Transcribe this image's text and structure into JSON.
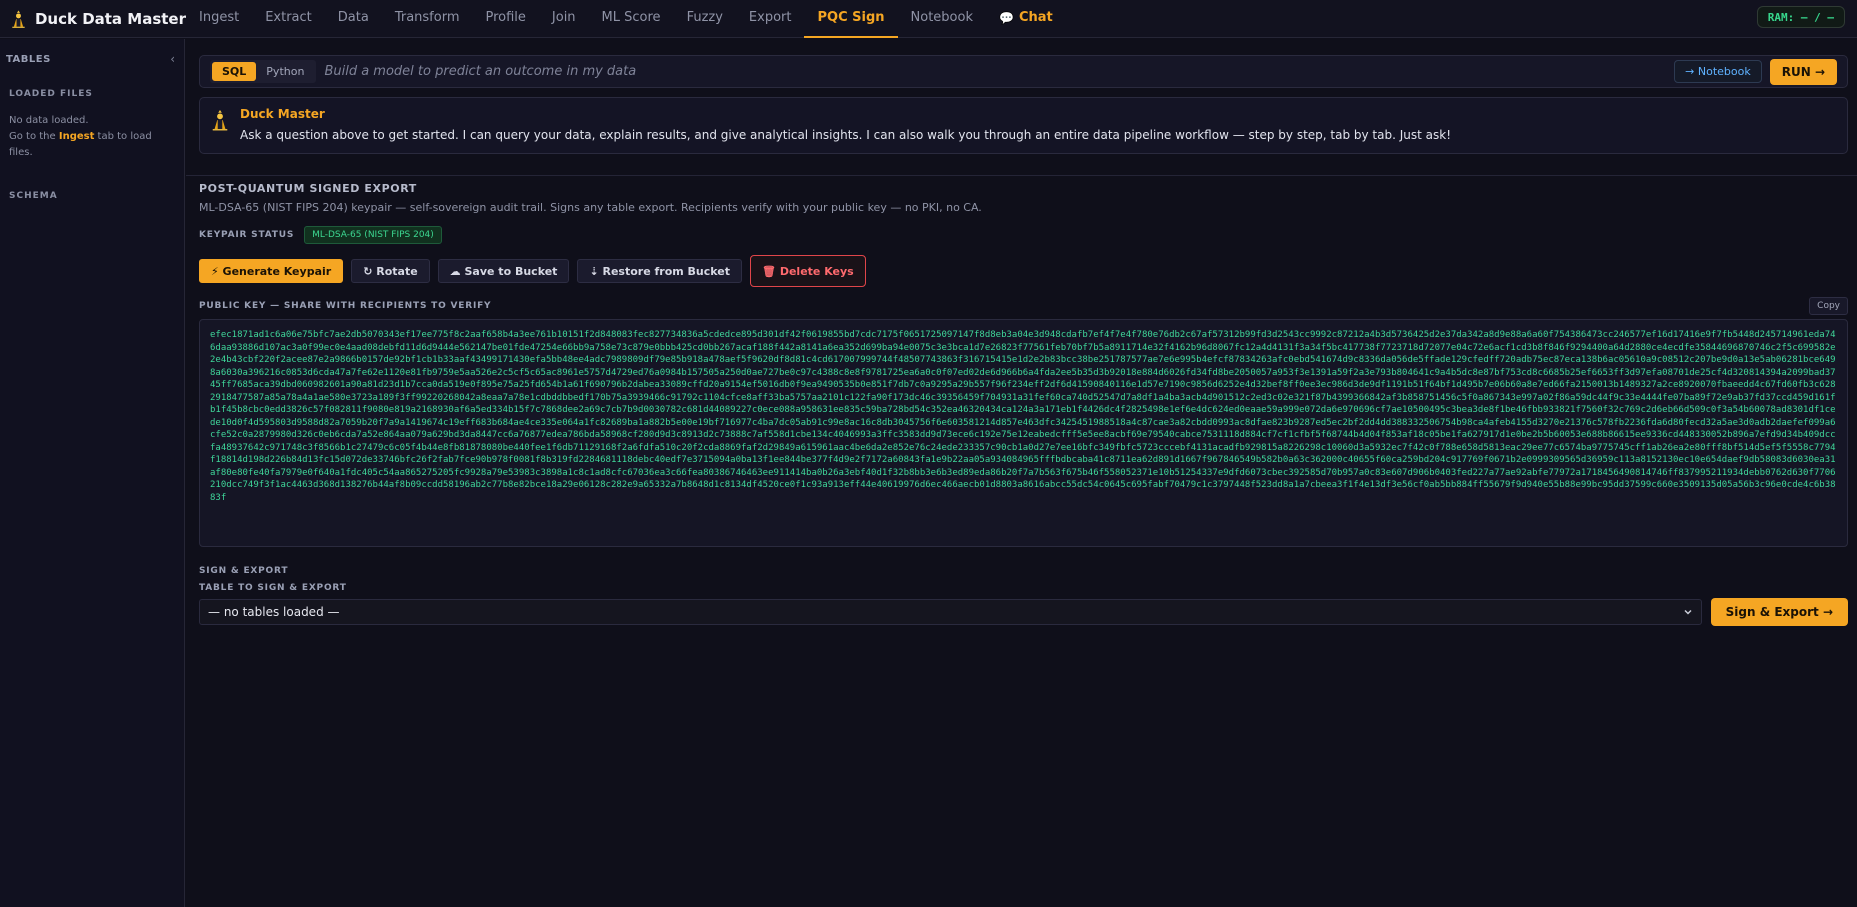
{
  "app": {
    "title": "Duck Data Master",
    "logo_icon": "duck-logo-icon"
  },
  "nav": {
    "tabs": [
      {
        "label": "Ingest"
      },
      {
        "label": "Extract"
      },
      {
        "label": "Data"
      },
      {
        "label": "Transform"
      },
      {
        "label": "Profile"
      },
      {
        "label": "Join"
      },
      {
        "label": "ML Score"
      },
      {
        "label": "Fuzzy"
      },
      {
        "label": "Export"
      },
      {
        "label": "PQC Sign",
        "active": true
      },
      {
        "label": "Notebook"
      },
      {
        "label": "Chat",
        "icon": "chat-icon"
      }
    ]
  },
  "ram": {
    "label": "RAM: — / —"
  },
  "sidebar": {
    "title": "TABLES",
    "collapse_glyph": "‹",
    "loaded_files_heading": "LOADED FILES",
    "empty_line1": "No data loaded.",
    "empty_line2_pre": "Go to the ",
    "empty_line2_link": "Ingest",
    "empty_line2_post": " tab to load files.",
    "schema_heading": "SCHEMA"
  },
  "query": {
    "modes": [
      "SQL",
      "Python"
    ],
    "active_mode": "SQL",
    "placeholder": "Build a model to predict an outcome in my data",
    "notebook_button": "→ Notebook",
    "run_button": "RUN →"
  },
  "assistant": {
    "name": "Duck Master",
    "message": "Ask a question above to get started. I can query your data, explain results, and give analytical insights. I can also walk you through an entire data pipeline workflow — step by step, tab by tab. Just ask!"
  },
  "pqc": {
    "title": "POST-QUANTUM SIGNED EXPORT",
    "subtitle": "ML-DSA-65 (NIST FIPS 204) keypair — self-sovereign audit trail. Signs any table export. Recipients verify with your public key — no PKI, no CA.",
    "keypair_status_label": "KEYPAIR STATUS",
    "keypair_status_badge": "ML-DSA-65 (NIST FIPS 204)",
    "buttons": {
      "generate": "⚡ Generate Keypair",
      "rotate": "↻ Rotate",
      "save": "☁ Save to Bucket",
      "restore": "⇣ Restore from Bucket",
      "delete": "🗑 Delete Keys"
    },
    "public_key_label": "PUBLIC KEY — SHARE WITH RECIPIENTS TO VERIFY",
    "copy_button": "Copy",
    "public_key": "efec1871ad1c6a06e75bfc7ae2db5070343ef17ee775f8c2aaf658b4a3ee761b10151f2d848083fec827734836a5cdedce895d301df42f0619855bd7cdc7175f0651725097147f8d8eb3a04e3d948cdafb7ef4f7e4f780e76db2c67af57312b99fd3d2543cc9992c87212a4b3d5736425d2e37da342a8d9e88a6a60f754386473cc246577ef16d17416e9f7fb5448d245714961eda746daa93886d107ac3a0f99ec0e4aad08debfd11d6d9444e562147be01fde47254e66bb9a758e73c879e0bbb425cd0bb267acaf188f442a8141a6ea352d699ba94e0075c3e3bca1d7e26823f77561feb70bf7b5a8911714e32f4162b96d8067fc12a4d4131f3a34f5bc417738f7723718d72077e04c72e6acf1cd3b8f846f9294400a64d2880ce4ecdfe35844696870746c2f5c699582e2e4b43cbf220f2acee87e2a9866b0157de92bf1cb1b33aaf43499171430efa5bb48ee4adc7989809df79e85b918a478aef5f9620df8d81c4cd617007999744f48507743863f316715415e1d2e2b83bcc38be251787577ae7e6e995b4efcf87834263afc0ebd541674d9c8336da056de5ffade129cfedff720adb75ec87eca138b6ac05610a9c08512c207be9d0a13e5ab06281bce6498a6030a396216c0853d6cda47a7fe62e1120e81fb9759e5aa526e2c5cf5c65ac8961e5757d4729ed76a0984b157505a250d0ae727be0c97c4388c8e8f9781725ea6a0c0f07ed02de6d966b6a4fda2ee5b35d3b92018e884d6026fd34fd8be2050057a953f3e1391a59f2a3e793b804641c9a4b5dc8e87bf753cd8c6685b25ef6653ff3d97efa08701de25cf4d320814394a2099bad3745ff7685aca39dbd060982601a90a81d23d1b7cca0da519e0f895e75a25fd654b1a61f690796b2dabea33089cffd20a9154ef5016db0f9ea9490535b0e851f7db7c0a9295a29b557f96f234eff2df6d41590840116e1d57e7190c9856d6252e4d32bef8ff0ee3ec986d3de9df1191b51f64bf1d495b7e06b60a8e7ed66fa2150013b1489327a2ce8920070fbaeedd4c67fd60fb3c6282918477587a85a78a4a1ae580e3723a189f3ff99220268042a8eaa7a78e1cdbddbbedf170b75a3939466c91792c1104cfce8aff33ba5757aa2101c122fa90f173dc46c39356459f704931a31fef60ca740d52547d7a8df1a4ba3acb4d901512c2ed3c02e321f87b4399366842af3b858751456c5f0a867343e997a02f86a59dc44f9c33e4444fe07ba89f72e9ab37fd37ccd459d161fb1f45b8cbc0edd3826c57f082811f9080e819a2168930af6a5ed334b15f7c7868dee2a69c7cb7b9d0030782c681d44089227c0ece088a958631ee835c59ba728bd54c352ea46320434ca124a3a171eb1f4426dc4f2825498e1ef6e4dc624ed0eaae59a999e072da6e970696cf7ae10500495c3bea3de8f1be46fbb933821f7560f32c769c2d6eb66d509c0f3a54b60078ad8301df1cede10d0f4d595803d9588d82a7059b20f7a9a1419674c19eff683b684ae4ce335e064a1fc82689ba1a882b5e00e19bf716977c4ba7dc05ab91c99e8ac16c8db3045756f6e603581214d857e463dfc3425451988518a4c87cae3a82cbdd0993ac8dfae823b9287ed5ec2bf2dd4dd388332506754b98ca4afeb4155d3270e21376c578fb2236fda6d80fecd32a5ae3d0adb2daefef099a6cfe52c0a2879980d326c0eb6cda7a52e864aa079a629bd3da8447cc6a76877edea786bda58968cf280d9d3c8913d2c73888c7af558d1cbe134c4046993a3ffc3583dd9d73ece6c192e75e12eabedcfff5e5ee8acbf69e79540cabce7531118d884cf7cf1cfbf5f68744b4d04f853af18c05be1fa627917d1e0be2b5b60053e688b86615ee9336cd448330052b896a7efd9d34b409dccfa48937642c971748c3f8566b1c27479c6c05f4b44e8fb81878080be440fee1f6db71129168f2a6fdfa510c20f2cda8869faf2d29849a615961aac4be6da2e852e76c24ede233357c90cb1a0d27e7ee16bfc349fbfc5723cccebf4131acadfb929815a8226298c10060d3a5932ec7f42c0f788e658d5813eac29ee77c6574ba9775745cff1ab26ea2e80fff8bf514d5ef5f5558c7794f18814d198d226b84d13fc15d072de33746bfc26f2fab7fce90b978f0081f8b319fd2284681118debc40edf7e3715094a0ba13f1ee844be377f4d9e2f7172a60843fa1e9b22aa05a934084965fffbdbcaba41c8711ea62d891d1667f967846549b582b0a63c362000c40655f60ca259bd204c917769f0671b2e0999309565d36959c113a8152130ec10e654daef9db58083d6030ea31af80e80fe40fa7979e0f640a1fdc405c54aa865275205fc9928a79e53983c3898a1c8c1ad8cfc67036ea3c66fea80386746463ee911414ba0b26a3ebf40d1f32b8bb3e6b3ed89eda86b20f7a7b563f675b46f558052371e10b51254337e9dfd6073cbec392585d70b957a0c83e607d906b0403fed227a77ae92abfe77972a1718456490814746ff837995211934debb0762d630f7706210dcc749f3f1ac4463d368d138276b44af8b09ccdd58196ab2c77b8e82bce18a29e06128c282e9a65332a7b8648d1c8134df4520ce0f1c93a913eff44e40619976d6ec466aecb01d8803a8616abcc55dc54c0645c695fabf70479c1c3797448f523dd8a1a7cbeea3f1f4e13df3e56cf0ab5bb884ff55679f9d940e55b88e99bc95dd37599c660e3509135d05a56b3c96e0cde4c6b3883f",
    "sign_section_title": "SIGN & EXPORT",
    "table_select_label": "TABLE TO SIGN & EXPORT",
    "table_select_value": "— no tables loaded —",
    "sign_button": "Sign & Export →"
  }
}
